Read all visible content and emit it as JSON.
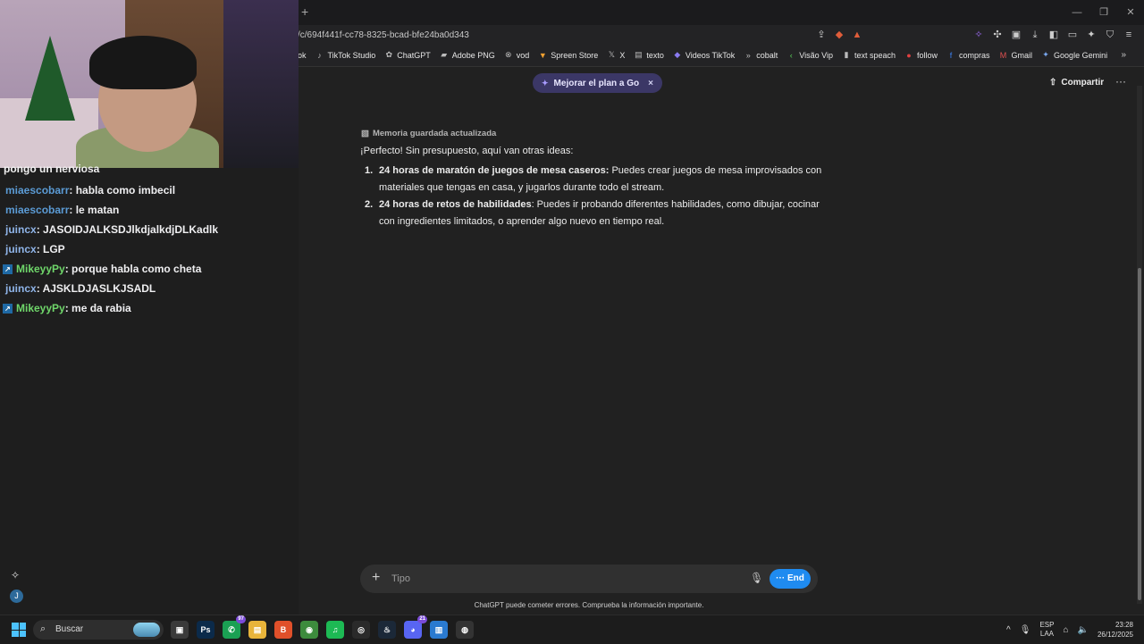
{
  "browser": {
    "new_tab": "+",
    "url": "/c/694f441f-cc78-8325-bcad-bfe24ba0d343",
    "window_controls": [
      "—",
      "❐",
      "✕"
    ],
    "bookmarks": [
      {
        "label": "ok",
        "icon": "partial-icon"
      },
      {
        "label": "TikTok Studio",
        "icon": "tiktok-icon"
      },
      {
        "label": "ChatGPT",
        "icon": "chatgpt-icon"
      },
      {
        "label": "Adobe PNG",
        "icon": "adobe-icon"
      },
      {
        "label": "vod",
        "icon": "vod-icon"
      },
      {
        "label": "Spreen Store",
        "icon": "store-icon"
      },
      {
        "label": "X",
        "icon": "x-icon"
      },
      {
        "label": "texto",
        "icon": "text-icon"
      },
      {
        "label": "Videos TikTok",
        "icon": "video-icon"
      },
      {
        "label": "cobalt",
        "icon": "cobalt-icon"
      },
      {
        "label": "Visão Vip",
        "icon": "vip-icon"
      },
      {
        "label": "text speach",
        "icon": "speech-icon"
      },
      {
        "label": "follow",
        "icon": "follow-icon"
      },
      {
        "label": "compras",
        "icon": "facebook-icon"
      },
      {
        "label": "Gmail",
        "icon": "gmail-icon"
      },
      {
        "label": "Google Gemini",
        "icon": "gemini-icon"
      }
    ],
    "bookmarks_more": "»"
  },
  "stream_chat": {
    "top_partial": "pongo un nerviosa",
    "messages": [
      {
        "user": "miaescobarr",
        "text": ": habla como imbecil",
        "color": "#5b9bd5",
        "badge": false
      },
      {
        "user": "miaescobarr",
        "text": ": le matan",
        "color": "#5b9bd5",
        "badge": false
      },
      {
        "user": "juincx",
        "text": ": JASOIDJALKSDJlkdjalkdjDLKadlk",
        "color": "#8fb4e8",
        "badge": false
      },
      {
        "user": "juincx",
        "text": ": LGP",
        "color": "#8fb4e8",
        "badge": false
      },
      {
        "user": "MikeyyPy",
        "text": ": porque habla como cheta",
        "color": "#6fd66a",
        "badge": true
      },
      {
        "user": "juincx",
        "text": ": AJSKLDJASLKJSADL",
        "color": "#8fb4e8",
        "badge": false
      },
      {
        "user": "MikeyyPy",
        "text": ": me da rabia",
        "color": "#6fd66a",
        "badge": true
      }
    ],
    "avatar_letter": "J"
  },
  "header": {
    "upgrade_label": "Mejorar el plan a Go",
    "upgrade_close": "×",
    "share_label": "Compartir",
    "more_label": "···"
  },
  "conversation": {
    "memory_note": "Memoria guardada actualizada",
    "intro": "¡Perfecto! Sin presupuesto, aquí van otras ideas:",
    "items": [
      {
        "num": "1.",
        "title": "24 horas de maratón de juegos de mesa caseros:",
        "text": " Puedes crear juegos de mesa improvisados con materiales que tengas en casa, y jugarlos durante todo el stream."
      },
      {
        "num": "2.",
        "title": "24 horas de retos de habilidades",
        "text": ": Puedes ir probando diferentes habilidades, como dibujar, cocinar con ingredientes limitados, o aprender algo nuevo en tiempo real."
      }
    ]
  },
  "composer": {
    "placeholder": "Tipo",
    "end_label": "··· End",
    "disclaimer": "ChatGPT puede cometer errores. Comprueba la información importante."
  },
  "taskbar": {
    "search_label": "Buscar",
    "apps": [
      {
        "name": "task-view",
        "label": "▣",
        "bg": "#3a3a3a",
        "count": ""
      },
      {
        "name": "photoshop",
        "label": "Ps",
        "bg": "#0b2a4a",
        "count": ""
      },
      {
        "name": "whatsapp",
        "label": "✆",
        "bg": "#1aa053",
        "count": "97"
      },
      {
        "name": "file-explorer",
        "label": "▤",
        "bg": "#e8b43a",
        "count": ""
      },
      {
        "name": "brave",
        "label": "B",
        "bg": "#e0502a",
        "count": ""
      },
      {
        "name": "chrome",
        "label": "◉",
        "bg": "#3d8b3d",
        "count": ""
      },
      {
        "name": "spotify",
        "label": "♫",
        "bg": "#1db954",
        "count": ""
      },
      {
        "name": "obs",
        "label": "◎",
        "bg": "#2a2a2a",
        "count": ""
      },
      {
        "name": "steam",
        "label": "♨",
        "bg": "#1b2838",
        "count": ""
      },
      {
        "name": "discord",
        "label": "◕",
        "bg": "#5865f2",
        "count": "21"
      },
      {
        "name": "notepad",
        "label": "▥",
        "bg": "#2a7ad0",
        "count": ""
      },
      {
        "name": "webcam-app",
        "label": "◍",
        "bg": "#333333",
        "count": ""
      }
    ],
    "chevron": "^",
    "lang_top": "ESP",
    "lang_bottom": "LAA",
    "time": "23:28",
    "date": "26/12/2025"
  }
}
